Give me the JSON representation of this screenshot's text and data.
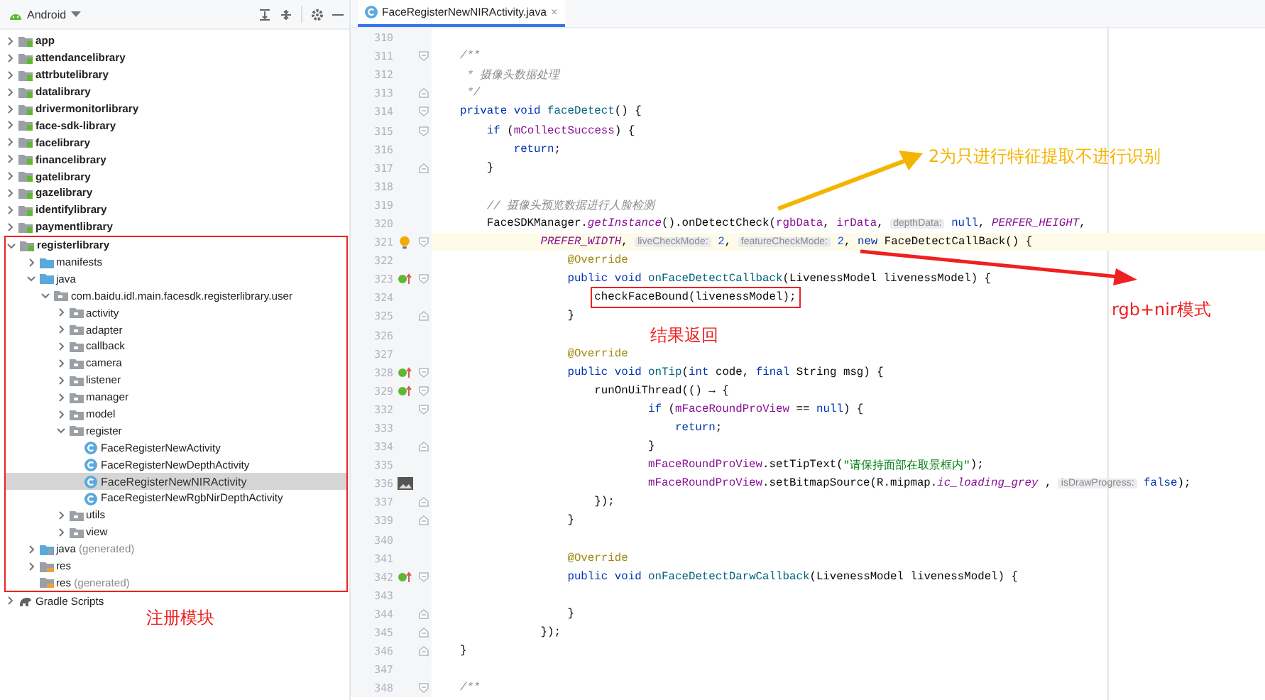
{
  "project_panel": {
    "view_selector": "Android",
    "tree": [
      {
        "label": "app",
        "kind": "module",
        "expanded": false,
        "selected": false
      },
      {
        "label": "attendancelibrary",
        "kind": "module",
        "expanded": false,
        "selected": false
      },
      {
        "label": "attrbutelibrary",
        "kind": "module",
        "expanded": false,
        "selected": false
      },
      {
        "label": "datalibrary",
        "kind": "module",
        "expanded": false,
        "selected": false
      },
      {
        "label": "drivermonitorlibrary",
        "kind": "module",
        "expanded": false,
        "selected": false
      },
      {
        "label": "face-sdk-library",
        "kind": "module",
        "expanded": false,
        "selected": false
      },
      {
        "label": "facelibrary",
        "kind": "module",
        "expanded": false,
        "selected": false
      },
      {
        "label": "financelibrary",
        "kind": "module",
        "expanded": false,
        "selected": false
      },
      {
        "label": "gatelibrary",
        "kind": "module",
        "expanded": false,
        "selected": false
      },
      {
        "label": "gazelibrary",
        "kind": "module",
        "expanded": false,
        "selected": false
      },
      {
        "label": "identifylibrary",
        "kind": "module",
        "expanded": false,
        "selected": false
      },
      {
        "label": "paymentlibrary",
        "kind": "module",
        "expanded": false,
        "selected": false
      },
      {
        "label": "registerlibrary",
        "kind": "module",
        "expanded": true,
        "selected": false,
        "boxed": true,
        "children": [
          {
            "label": "manifests",
            "kind": "folder",
            "expanded": false,
            "selected": false
          },
          {
            "label": "java",
            "kind": "folder",
            "expanded": true,
            "selected": false,
            "children": [
              {
                "label": "com.baidu.idl.main.facesdk.registerlibrary.user",
                "kind": "package",
                "expanded": true,
                "selected": false,
                "children": [
                  {
                    "label": "activity",
                    "kind": "package",
                    "expanded": false,
                    "selected": false
                  },
                  {
                    "label": "adapter",
                    "kind": "package",
                    "expanded": false,
                    "selected": false
                  },
                  {
                    "label": "callback",
                    "kind": "package",
                    "expanded": false,
                    "selected": false
                  },
                  {
                    "label": "camera",
                    "kind": "package",
                    "expanded": false,
                    "selected": false
                  },
                  {
                    "label": "listener",
                    "kind": "package",
                    "expanded": false,
                    "selected": false
                  },
                  {
                    "label": "manager",
                    "kind": "package",
                    "expanded": false,
                    "selected": false
                  },
                  {
                    "label": "model",
                    "kind": "package",
                    "expanded": false,
                    "selected": false
                  },
                  {
                    "label": "register",
                    "kind": "package",
                    "expanded": true,
                    "selected": false,
                    "children": [
                      {
                        "label": "FaceRegisterNewActivity",
                        "kind": "class",
                        "selected": false
                      },
                      {
                        "label": "FaceRegisterNewDepthActivity",
                        "kind": "class",
                        "selected": false
                      },
                      {
                        "label": "FaceRegisterNewNIRActivity",
                        "kind": "class",
                        "selected": true
                      },
                      {
                        "label": "FaceRegisterNewRgbNirDepthActivity",
                        "kind": "class",
                        "selected": false
                      }
                    ]
                  },
                  {
                    "label": "utils",
                    "kind": "package",
                    "expanded": false,
                    "selected": false
                  },
                  {
                    "label": "view",
                    "kind": "package",
                    "expanded": false,
                    "selected": false
                  }
                ]
              }
            ]
          },
          {
            "label": "java",
            "suffix": "(generated)",
            "kind": "generated",
            "expanded": false,
            "selected": false
          },
          {
            "label": "res",
            "kind": "res",
            "expanded": false,
            "selected": false
          },
          {
            "label": "res",
            "suffix": "(generated)",
            "kind": "res",
            "selected": false
          }
        ]
      },
      {
        "label": "Gradle Scripts",
        "kind": "gradle",
        "expanded": false,
        "selected": false
      }
    ]
  },
  "editor": {
    "tab": {
      "label": "FaceRegisterNewNIRActivity.java",
      "close": "×"
    },
    "lines": [
      {
        "number": "310"
      },
      {
        "number": "311",
        "fold_marker": {
          "kind": "open"
        },
        "tokens": [
          {
            "kind": "comment",
            "text": "    /**"
          }
        ]
      },
      {
        "number": "312",
        "tokens": [
          {
            "kind": "comment",
            "text": "     * 摄像头数据处理"
          }
        ]
      },
      {
        "number": "313",
        "fold_marker": {
          "kind": "close"
        },
        "tokens": [
          {
            "kind": "comment",
            "text": "     */"
          }
        ]
      },
      {
        "number": "314",
        "fold_marker": {
          "kind": "open"
        },
        "tokens": [
          {
            "kind": "keyword",
            "text": "    private "
          },
          {
            "kind": "keyword",
            "text": "void "
          },
          {
            "kind": "method",
            "text": "faceDetect"
          },
          {
            "kind": "plain",
            "text": "() {"
          }
        ]
      },
      {
        "number": "315",
        "fold_marker": {
          "kind": "open"
        },
        "tokens": [
          {
            "kind": "keyword",
            "text": "        if"
          },
          {
            "kind": "plain",
            "text": " ("
          },
          {
            "kind": "field",
            "text": "mCollectSuccess"
          },
          {
            "kind": "plain",
            "text": ") {"
          }
        ]
      },
      {
        "number": "316",
        "tokens": [
          {
            "kind": "keyword",
            "text": "            return"
          },
          {
            "kind": "plain",
            "text": ";"
          }
        ]
      },
      {
        "number": "317",
        "fold_marker": {
          "kind": "close"
        },
        "tokens": [
          {
            "kind": "plain",
            "text": "        }"
          }
        ]
      },
      {
        "number": "318"
      },
      {
        "number": "319",
        "tokens": [
          {
            "kind": "comment",
            "text": "        // 摄像头预览数据进行人脸检测"
          }
        ]
      },
      {
        "number": "320",
        "tokens": [
          {
            "kind": "plain",
            "text": "        FaceSDKManager."
          },
          {
            "kind": "static",
            "text": "getInstance"
          },
          {
            "kind": "plain",
            "text": "().onDetectCheck("
          },
          {
            "kind": "field",
            "text": "rgbData"
          },
          {
            "kind": "plain",
            "text": ", "
          },
          {
            "kind": "field",
            "text": "irData"
          },
          {
            "kind": "plain",
            "text": ", "
          },
          {
            "kind": "hint",
            "text": "depthData:"
          },
          {
            "kind": "keyword",
            "text": " null"
          },
          {
            "kind": "plain",
            "text": ", "
          },
          {
            "kind": "constant",
            "text": "PERFER_HEIGHT"
          },
          {
            "kind": "plain",
            "text": ","
          }
        ]
      },
      {
        "number": "321",
        "current": true,
        "gutter_icon": {
          "kind": "bulb"
        },
        "fold_marker": {
          "kind": "open"
        },
        "tokens": [
          {
            "kind": "constant",
            "text": "                PREFER_WIDTH"
          },
          {
            "kind": "plain",
            "text": ", "
          },
          {
            "kind": "hint",
            "text": "liveCheckMode:"
          },
          {
            "kind": "number",
            "text": " 2"
          },
          {
            "kind": "plain",
            "text": ", "
          },
          {
            "kind": "hint",
            "text": "featureCheckMode:"
          },
          {
            "kind": "number",
            "text": " 2"
          },
          {
            "kind": "plain",
            "text": ", "
          },
          {
            "kind": "keyword",
            "text": "new"
          },
          {
            "kind": "plain",
            "text": " FaceDetectCallBack() {"
          }
        ]
      },
      {
        "number": "322",
        "tokens": [
          {
            "kind": "annotation",
            "text": "                    @Override"
          }
        ]
      },
      {
        "number": "323",
        "gutter_icon": {
          "kind": "override"
        },
        "fold_marker": {
          "kind": "open"
        },
        "tokens": [
          {
            "kind": "keyword",
            "text": "                    public "
          },
          {
            "kind": "keyword",
            "text": "void "
          },
          {
            "kind": "method",
            "text": "onFaceDetectCallback"
          },
          {
            "kind": "plain",
            "text": "(LivenessModel livenessModel) {"
          }
        ]
      },
      {
        "number": "324",
        "tokens": [
          {
            "kind": "plain",
            "text": "                        checkFaceBound(livenessModel);",
            "boxed": true
          }
        ]
      },
      {
        "number": "325",
        "fold_marker": {
          "kind": "close"
        },
        "tokens": [
          {
            "kind": "plain",
            "text": "                    }"
          }
        ]
      },
      {
        "number": "326"
      },
      {
        "number": "327",
        "tokens": [
          {
            "kind": "annotation",
            "text": "                    @Override"
          }
        ]
      },
      {
        "number": "328",
        "gutter_icon": {
          "kind": "override"
        },
        "fold_marker": {
          "kind": "open"
        },
        "tokens": [
          {
            "kind": "keyword",
            "text": "                    public "
          },
          {
            "kind": "keyword",
            "text": "void "
          },
          {
            "kind": "method",
            "text": "onTip"
          },
          {
            "kind": "plain",
            "text": "("
          },
          {
            "kind": "keyword",
            "text": "int"
          },
          {
            "kind": "plain",
            "text": " code, "
          },
          {
            "kind": "keyword",
            "text": "final"
          },
          {
            "kind": "plain",
            "text": " String msg) {"
          }
        ]
      },
      {
        "number": "329",
        "gutter_icon": {
          "kind": "override"
        },
        "fold_marker": {
          "kind": "open"
        },
        "tokens": [
          {
            "kind": "plain",
            "text": "                        runOnUiThread(() → {"
          }
        ]
      },
      {
        "number": "332",
        "fold_marker": {
          "kind": "open"
        },
        "tokens": [
          {
            "kind": "keyword",
            "text": "                                if"
          },
          {
            "kind": "plain",
            "text": " ("
          },
          {
            "kind": "field",
            "text": "mFaceRoundProView"
          },
          {
            "kind": "plain",
            "text": " == "
          },
          {
            "kind": "keyword",
            "text": "null"
          },
          {
            "kind": "plain",
            "text": ") {"
          }
        ]
      },
      {
        "number": "333",
        "tokens": [
          {
            "kind": "keyword",
            "text": "                                    return"
          },
          {
            "kind": "plain",
            "text": ";"
          }
        ]
      },
      {
        "number": "334",
        "fold_marker": {
          "kind": "close"
        },
        "tokens": [
          {
            "kind": "plain",
            "text": "                                }"
          }
        ]
      },
      {
        "number": "335",
        "tokens": [
          {
            "kind": "field",
            "text": "                                mFaceRoundProView"
          },
          {
            "kind": "plain",
            "text": ".setTipText("
          },
          {
            "kind": "string",
            "text": "\"请保持面部在取景框内\""
          },
          {
            "kind": "plain",
            "text": ");"
          }
        ]
      },
      {
        "number": "336",
        "gutter_icon": {
          "kind": "image"
        },
        "tokens": [
          {
            "kind": "field",
            "text": "                                mFaceRoundProView"
          },
          {
            "kind": "plain",
            "text": ".setBitmapSource(R.mipmap."
          },
          {
            "kind": "static",
            "text": "ic_loading_grey"
          },
          {
            "kind": "plain",
            "text": " , "
          },
          {
            "kind": "hint",
            "text": "isDrawProgress:"
          },
          {
            "kind": "keyword",
            "text": " false"
          },
          {
            "kind": "plain",
            "text": ");"
          }
        ]
      },
      {
        "number": "337",
        "fold_marker": {
          "kind": "close"
        },
        "tokens": [
          {
            "kind": "plain",
            "text": "                        });"
          }
        ]
      },
      {
        "number": "339",
        "fold_marker": {
          "kind": "close"
        },
        "tokens": [
          {
            "kind": "plain",
            "text": "                    }"
          }
        ]
      },
      {
        "number": "340"
      },
      {
        "number": "341",
        "tokens": [
          {
            "kind": "annotation",
            "text": "                    @Override"
          }
        ]
      },
      {
        "number": "342",
        "gutter_icon": {
          "kind": "override"
        },
        "fold_marker": {
          "kind": "open"
        },
        "tokens": [
          {
            "kind": "keyword",
            "text": "                    public "
          },
          {
            "kind": "keyword",
            "text": "void "
          },
          {
            "kind": "method",
            "text": "onFaceDetectDarwCallback"
          },
          {
            "kind": "plain",
            "text": "(LivenessModel livenessModel) {"
          }
        ]
      },
      {
        "number": "343"
      },
      {
        "number": "344",
        "fold_marker": {
          "kind": "close"
        },
        "tokens": [
          {
            "kind": "plain",
            "text": "                    }"
          }
        ]
      },
      {
        "number": "345",
        "fold_marker": {
          "kind": "close"
        },
        "tokens": [
          {
            "kind": "plain",
            "text": "                });"
          }
        ]
      },
      {
        "number": "346",
        "fold_marker": {
          "kind": "close"
        },
        "tokens": [
          {
            "kind": "plain",
            "text": "    }"
          }
        ]
      },
      {
        "number": "347"
      },
      {
        "number": "348",
        "fold_marker": {
          "kind": "open"
        },
        "tokens": [
          {
            "kind": "comment",
            "text": "    /**"
          }
        ]
      }
    ]
  },
  "callouts": [
    {
      "text": "2为只进行特征提取不进行识别",
      "color": "#f5b400"
    },
    {
      "text": "rgb+nir模式",
      "color": "#f02020"
    },
    {
      "text": "结果返回",
      "color": "#f02020"
    },
    {
      "text": "注册模块",
      "color": "#f02020"
    }
  ]
}
